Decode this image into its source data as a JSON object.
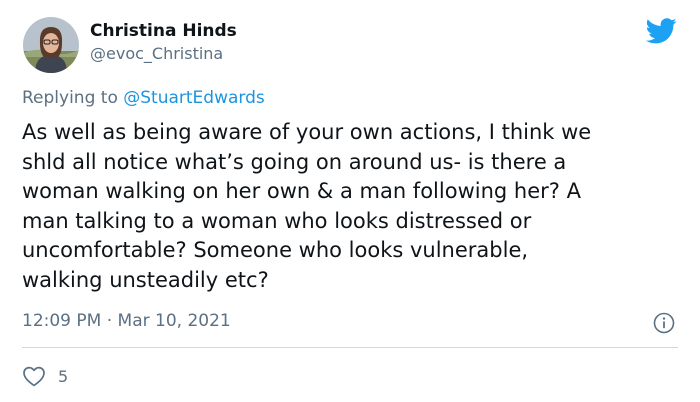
{
  "author": {
    "name": "Christina Hinds",
    "handle": "@evoc_Christina"
  },
  "reply": {
    "prefix": "Replying to ",
    "mention": "@StuartEdwards"
  },
  "tweet": {
    "text": "As well as being aware of your own actions, I think we\nshld all notice what’s going on around us- is there a\nwoman walking on her own & a man following her? A\nman talking to a woman who looks distressed or\nuncomfortable? Someone who looks vulnerable,\nwalking unsteadily etc?"
  },
  "meta": {
    "time": "12:09 PM",
    "separator": " · ",
    "date": "Mar 10, 2021"
  },
  "actions": {
    "like_count": "5"
  },
  "icons": {
    "brand": "twitter-bird-icon",
    "info": "info-icon",
    "like": "heart-icon"
  },
  "colors": {
    "brand_blue": "#1da1f2",
    "link_blue": "#1b95e0",
    "secondary_text": "#5b7083",
    "divider": "#cfd9de"
  }
}
